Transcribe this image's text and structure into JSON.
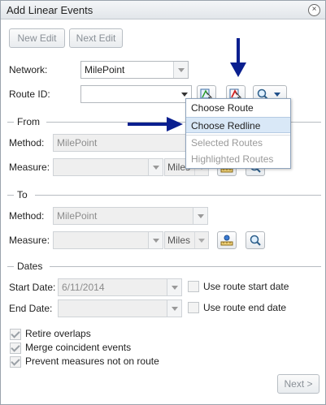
{
  "window": {
    "title": "Add Linear Events",
    "close_symbol": "×"
  },
  "toolbar": {
    "new_edit": "New Edit",
    "next_edit": "Next Edit"
  },
  "network": {
    "label": "Network:",
    "value": "MilePoint"
  },
  "route": {
    "label": "Route ID:",
    "value": ""
  },
  "route_menu": {
    "items": [
      {
        "label": "Choose Route",
        "enabled": true
      },
      {
        "label": "Choose Redline",
        "enabled": true,
        "highlighted": true
      },
      {
        "label": "Selected Routes",
        "enabled": false
      },
      {
        "label": "Highlighted Routes",
        "enabled": false
      }
    ]
  },
  "from": {
    "title": "From",
    "method_label": "Method:",
    "method_value": "MilePoint",
    "measure_label": "Measure:",
    "measure_value": "",
    "units": "Miles"
  },
  "to": {
    "title": "To",
    "method_label": "Method:",
    "method_value": "MilePoint",
    "measure_label": "Measure:",
    "measure_value": "",
    "units": "Miles"
  },
  "dates": {
    "title": "Dates",
    "start_label": "Start Date:",
    "start_value": "6/11/2014",
    "end_label": "End Date:",
    "end_value": "",
    "use_start": "Use route start date",
    "use_end": "Use route end date"
  },
  "options": {
    "retire_overlaps": "Retire overlaps",
    "merge_events": "Merge coincident events",
    "prevent_measures": "Prevent measures not on route"
  },
  "footer": {
    "next_label": "Next >"
  },
  "colors": {
    "annotation_arrow": "#0a1f8f",
    "menu_highlight": "#d9e8f7"
  }
}
